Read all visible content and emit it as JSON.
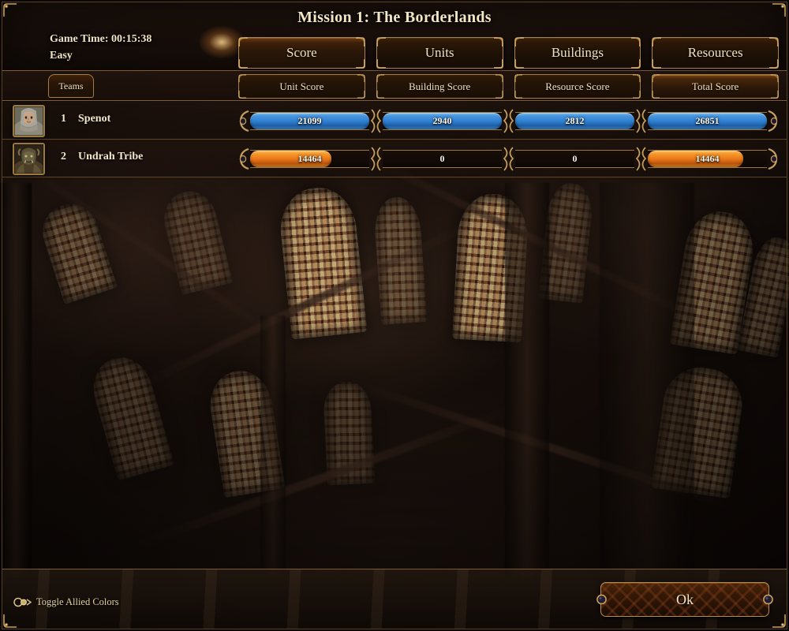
{
  "window": {
    "title": "Mission 1: The Borderlands"
  },
  "header": {
    "game_time_label": "Game Time: 00:15:38",
    "difficulty": "Easy",
    "tabs": [
      {
        "label": "Score",
        "active": true
      },
      {
        "label": "Units",
        "active": false
      },
      {
        "label": "Buildings",
        "active": false
      },
      {
        "label": "Resources",
        "active": false
      }
    ]
  },
  "subheader": {
    "teams_label": "Teams",
    "subtabs": [
      {
        "label": "Unit Score",
        "active": false
      },
      {
        "label": "Building Score",
        "active": false
      },
      {
        "label": "Resource Score",
        "active": false
      },
      {
        "label": "Total Score",
        "active": true
      }
    ]
  },
  "scoreboard": {
    "columns": [
      "Unit Score",
      "Building Score",
      "Resource Score",
      "Total Score"
    ],
    "rows": [
      {
        "rank": "1",
        "name": "Spenot",
        "color": "#3f8ed8",
        "portrait": "human-knight-portrait",
        "values": [
          "21099",
          "2940",
          "2812",
          "26851"
        ],
        "fills": [
          100,
          100,
          100,
          100
        ]
      },
      {
        "rank": "2",
        "name": "Undrah Tribe",
        "color": "#ea7c1c",
        "portrait": "orc-warrior-portrait",
        "values": [
          "14464",
          "0",
          "0",
          "14464"
        ],
        "fills": [
          68,
          0,
          0,
          80
        ]
      }
    ]
  },
  "footer": {
    "toggle_allied_label": "Toggle Allied Colors",
    "toggle_allied_icon": "toggle-switch-icon",
    "ok_label": "Ok"
  },
  "colors": {
    "gold_trim": "#b08a4a",
    "panel_bg": "#1c110b",
    "text": "#f2e7cb",
    "blue_bar": "#3f8ed8",
    "orange_bar": "#ea7c1c"
  }
}
